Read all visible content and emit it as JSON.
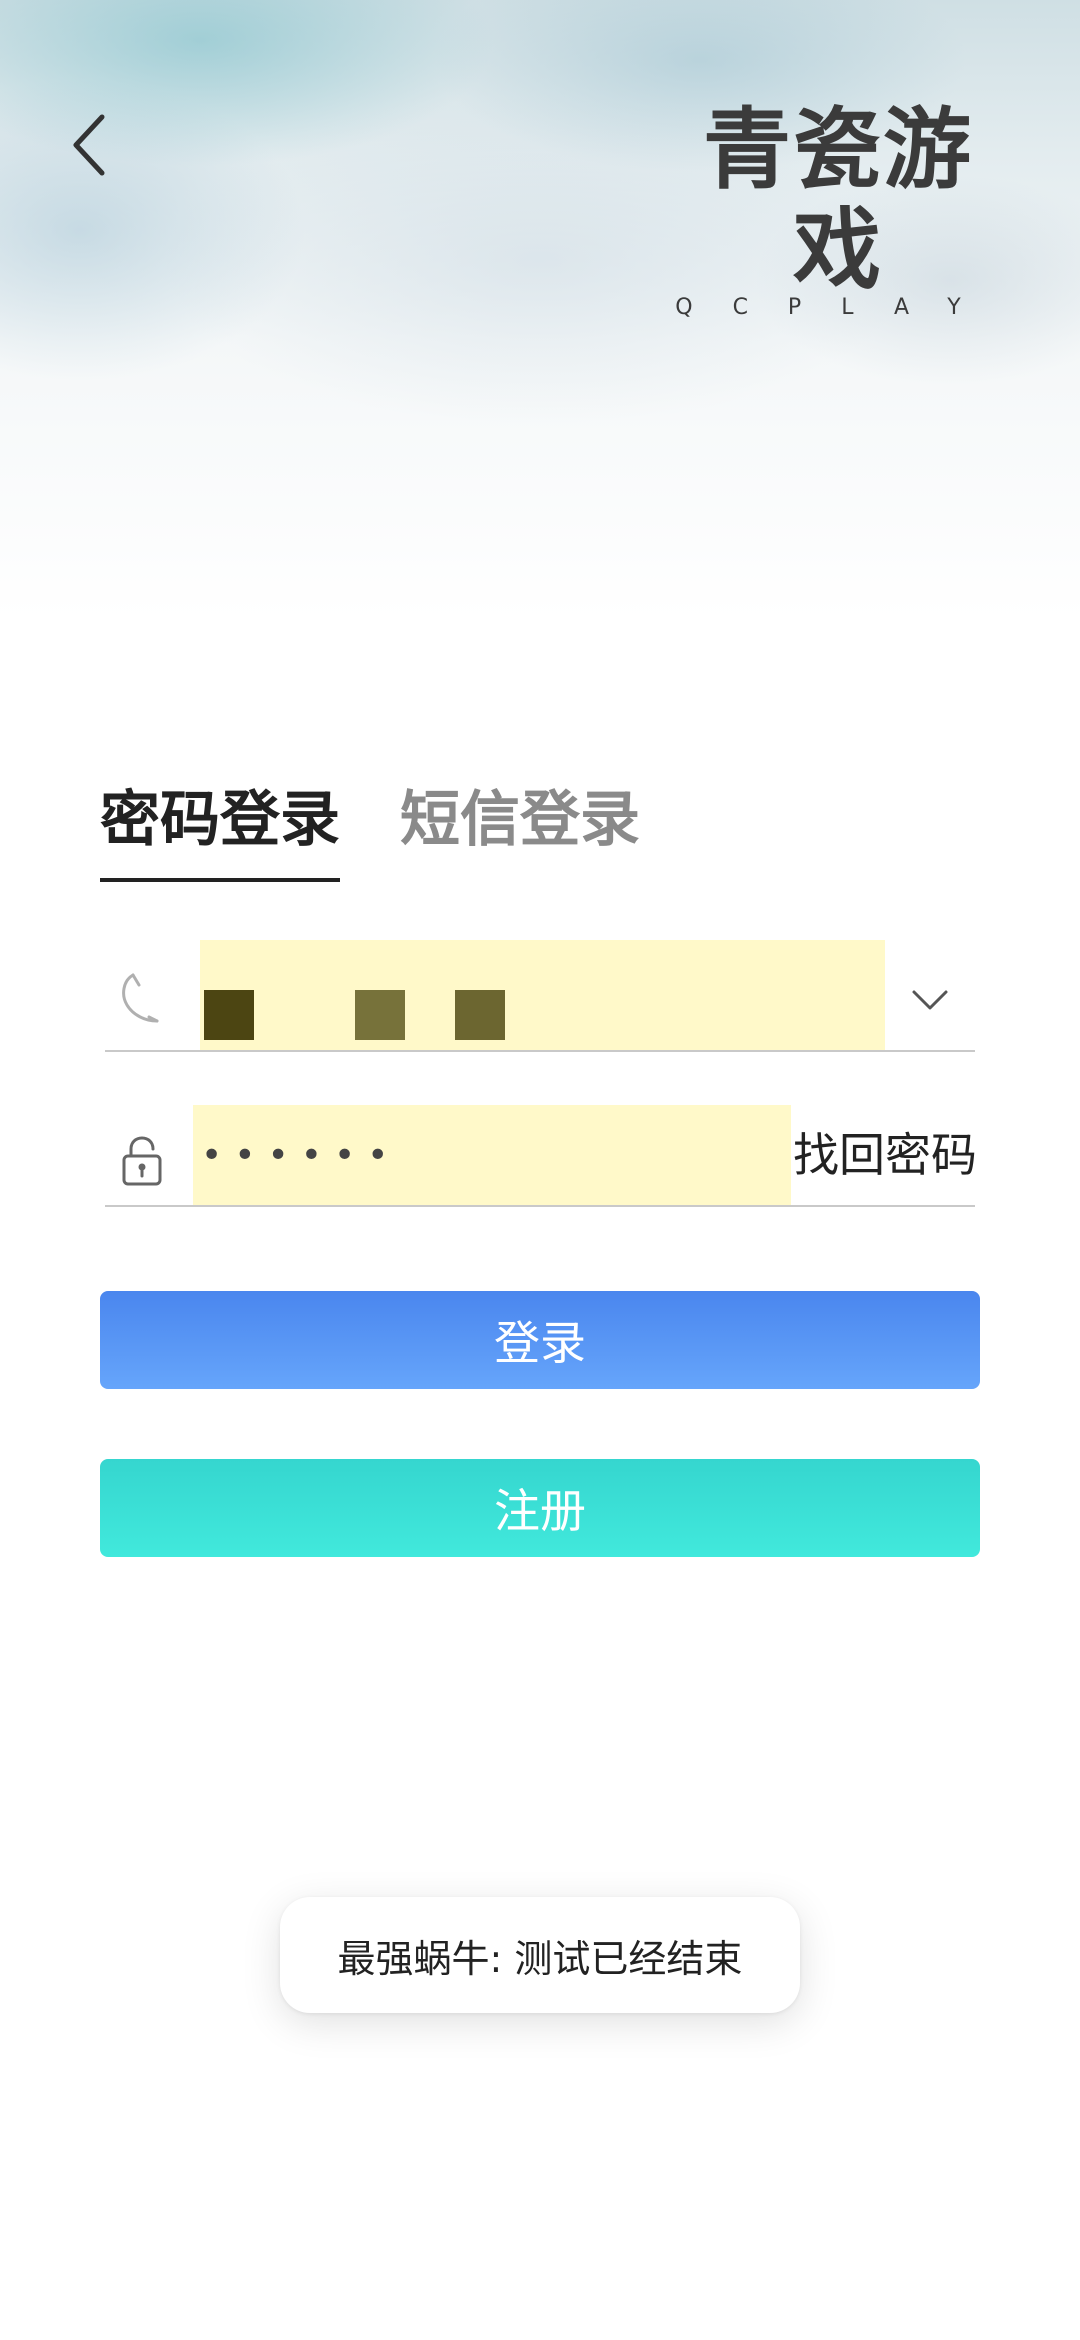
{
  "header": {
    "back_icon": "chevron-left-icon",
    "logo_cn": "青瓷游戏",
    "logo_en": "QCPLAY"
  },
  "tabs": [
    {
      "label": "密码登录",
      "active": true
    },
    {
      "label": "短信登录",
      "active": false
    }
  ],
  "phone_field": {
    "icon": "phone-icon",
    "value_masked": true,
    "dropdown_icon": "chevron-down-icon"
  },
  "password_field": {
    "icon": "lock-icon",
    "value": "••••••",
    "forgot_label": "找回密码"
  },
  "buttons": {
    "login_label": "登录",
    "register_label": "注册"
  },
  "toast": {
    "message": "最强蜗牛: 测试已经结束"
  },
  "colors": {
    "login_button": "#5596f4",
    "register_button": "#3be0d6",
    "field_highlight": "#fff9c9"
  }
}
